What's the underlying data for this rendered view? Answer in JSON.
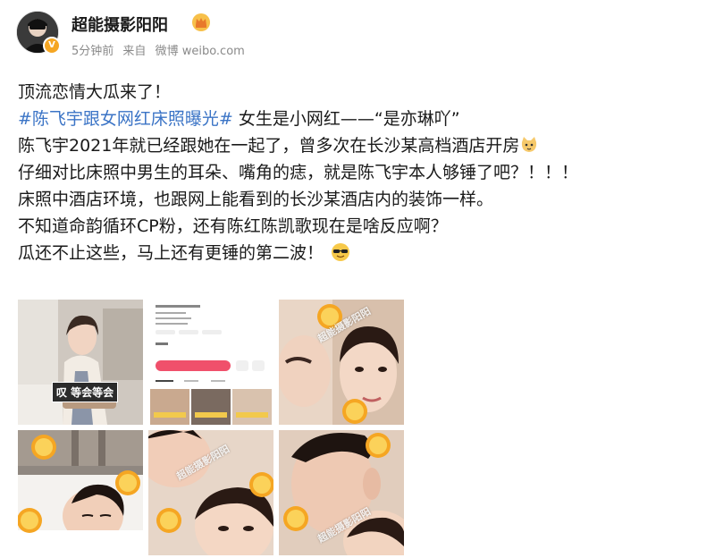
{
  "post": {
    "author": "超能摄影阳阳",
    "time": "5分钟前",
    "source_prefix": "来自",
    "source": "微博 weibo.com"
  },
  "content": {
    "line1": "顶流恋情大瓜来了！",
    "hashtag": "#陈飞宇跟女网红床照曝光#",
    "line2_rest": " 女生是小网红——“是亦琳吖”",
    "line3": "陈飞宇2021年就已经跟她在一起了，曾多次在长沙某高档酒店开房",
    "line4": "仔细对比床照中男生的耳朵、嘴角的痣，就是陈飞宇本人够锤了吧？！！！",
    "line5": "床照中酒店环境，也跟网上能看到的长沙某酒店内的装饰一样。",
    "line6": "不知道命韵循环CP粉，还有陈红陈凯歌现在是啥反应啊？",
    "line7": "瓜还不止这些，马上还有更锤的第二波！"
  },
  "images": {
    "caption1": "叹 等会等会",
    "watermark": "超能摄影阳阳",
    "stamp_text": "阳阳",
    "profile_name": "是亦琳吖"
  },
  "colors": {
    "hashtag": "#3b74c6",
    "meta": "#8a8a8a",
    "badge": "#f5a623"
  },
  "icons": {
    "verified": "verified-v-icon",
    "crown": "crown-badge-icon",
    "emoji_cat": "cat-face-emoji",
    "emoji_cool": "sunglasses-emoji"
  }
}
